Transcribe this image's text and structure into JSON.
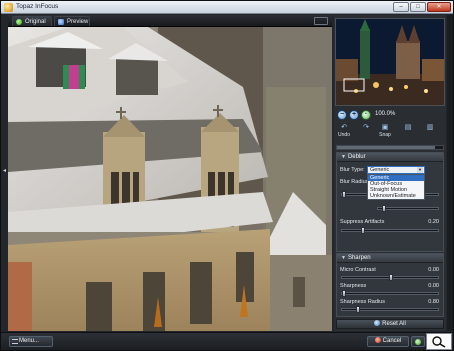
{
  "window": {
    "title": "Topaz InFocus",
    "buttons": {
      "minimize": "–",
      "maximize": "□",
      "close": "✕"
    }
  },
  "preview": {
    "tabs": [
      {
        "label": "Original",
        "icon": "green-dot-icon"
      },
      {
        "label": "Preview",
        "icon": "blue-square-icon"
      }
    ]
  },
  "navigator": {
    "zoom": "100.0%"
  },
  "toolbar": {
    "undo": "Undo",
    "snap": "Snap"
  },
  "deblur": {
    "title": "Deblur",
    "blur_type_label": "Blur Type:",
    "blur_type_value": "Generic",
    "blur_type_options": [
      "Generic",
      "Out-of-Focus",
      "Straight Motion",
      "Unknown/Estimate"
    ],
    "blur_radius_label": "Blur Radius",
    "suppress_artifacts_label": "Suppress Artifacts",
    "suppress_artifacts_value": "0.20",
    "suppress_artifacts_level": 0.2
  },
  "sharpen": {
    "title": "Sharpen",
    "micro_contrast_label": "Micro Contrast",
    "micro_contrast_value": "0.00",
    "sharpness_label": "Sharpness",
    "sharpness_value": "0.00",
    "sharpness_radius_label": "Sharpness Radius",
    "sharpness_radius_value": "0.80"
  },
  "panel": {
    "reset_label": "Reset All"
  },
  "footer": {
    "menu_label": "Menu...",
    "cancel_label": "Cancel"
  },
  "colors": {
    "accent_blue": "#2f6ec1",
    "panel_bg": "#2a2e33",
    "cancel_red": "#c8311c",
    "ok_green": "#39a329"
  }
}
